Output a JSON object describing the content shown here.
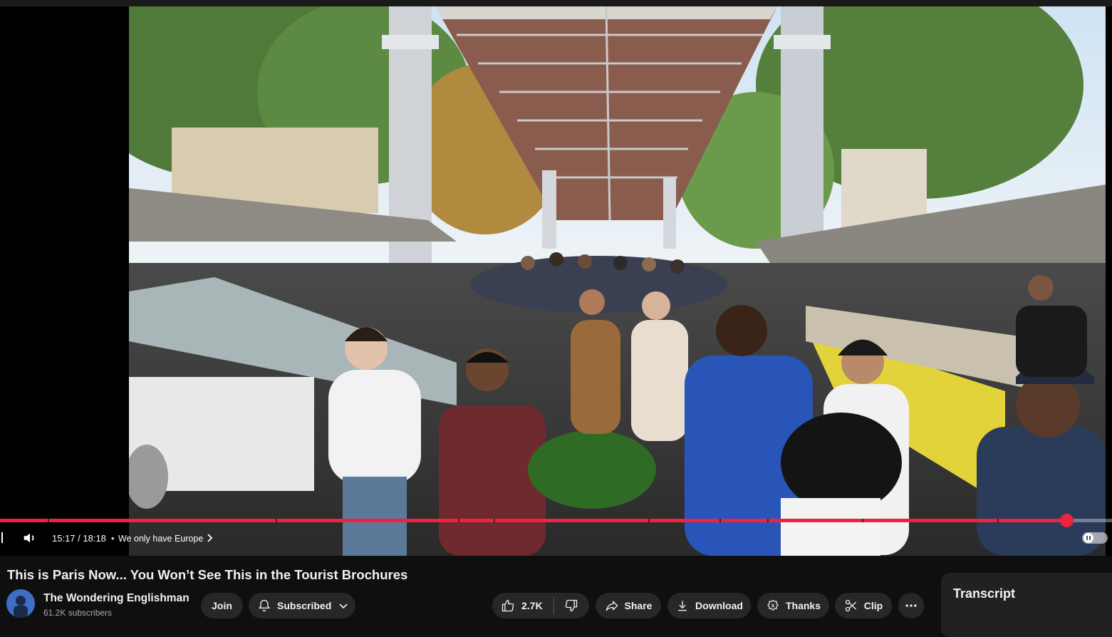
{
  "player": {
    "current_time": "15:17",
    "duration": "18:18",
    "time_display": "15:17 / 18:18",
    "chapter_separator": "•",
    "chapter_title": "We only have Europe",
    "progress_fraction": 0.959,
    "accent_color": "#f0223f",
    "chapter_marks": [
      0.043,
      0.248,
      0.412,
      0.444,
      0.583,
      0.647,
      0.69,
      0.775,
      0.897
    ]
  },
  "video": {
    "title": "This is Paris Now... You Won’t See This in the Tourist Brochures"
  },
  "channel": {
    "name": "The Wondering Englishman",
    "subscribers": "61.2K subscribers"
  },
  "actions": {
    "join": "Join",
    "subscribed": "Subscribed",
    "likes": "2.7K",
    "share": "Share",
    "download": "Download",
    "thanks": "Thanks",
    "clip": "Clip",
    "more_icon": "ellipsis-icon"
  },
  "side_panel": {
    "title": "Transcript"
  }
}
